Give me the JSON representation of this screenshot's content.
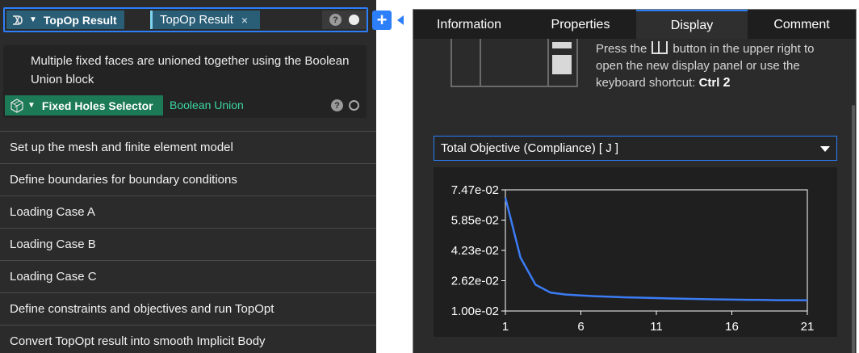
{
  "left_panel": {
    "topop_block": {
      "name": "TopOp Result",
      "input_chip": "TopOp Result",
      "remove_icon": "×",
      "help_icon": "?"
    },
    "fixed_holes_block": {
      "description": "Multiple fixed faces are unioned together using the Boolean Union block",
      "name": "Fixed Holes Selector",
      "link_label": "Boolean Union",
      "help_icon": "?"
    },
    "steps": [
      "Set up the mesh and finite element model",
      "Define boundaries for boundary conditions",
      "Loading Case A",
      "Loading Case B",
      "Loading Case C",
      "Define constraints and objectives and run TopOpt",
      "Convert TopOpt result into smooth Implicit Body"
    ]
  },
  "add_button": "+",
  "right_panel": {
    "tabs": [
      "Information",
      "Properties",
      "Display",
      "Comment"
    ],
    "active_tab": "Display",
    "hint": {
      "part1": "Press the",
      "part2": "button in the upper right to open the new display panel or use the keyboard shortcut:",
      "shortcut_key": "Ctrl",
      "shortcut_num": "2"
    },
    "select_value": "Total Objective (Compliance) [ J ]"
  },
  "colors": {
    "accent": "#2d7ff9",
    "topop_chip": "#2a5e77",
    "fixed_holes_chip": "#1d7a56",
    "link": "#3cd6a4",
    "series": "#3b7cf5"
  },
  "chart_data": {
    "type": "line",
    "title": "",
    "xlabel": "",
    "ylabel": "",
    "x_ticks": [
      "1",
      "6",
      "11",
      "16",
      "21"
    ],
    "y_ticks": [
      "7.47e-02",
      "5.85e-02",
      "4.23e-02",
      "2.62e-02",
      "1.00e-02"
    ],
    "xlim": [
      1,
      21
    ],
    "ylim": [
      0.01,
      0.0747
    ],
    "x": [
      1,
      2,
      3,
      4,
      5,
      6,
      7,
      8,
      9,
      10,
      11,
      12,
      13,
      14,
      15,
      16,
      17,
      18,
      19,
      20,
      21
    ],
    "y": [
      0.0705,
      0.0385,
      0.024,
      0.0198,
      0.0188,
      0.0183,
      0.0179,
      0.0176,
      0.0173,
      0.0171,
      0.0169,
      0.0167,
      0.0165,
      0.0164,
      0.0162,
      0.0161,
      0.016,
      0.0159,
      0.0158,
      0.0158,
      0.0157
    ]
  }
}
